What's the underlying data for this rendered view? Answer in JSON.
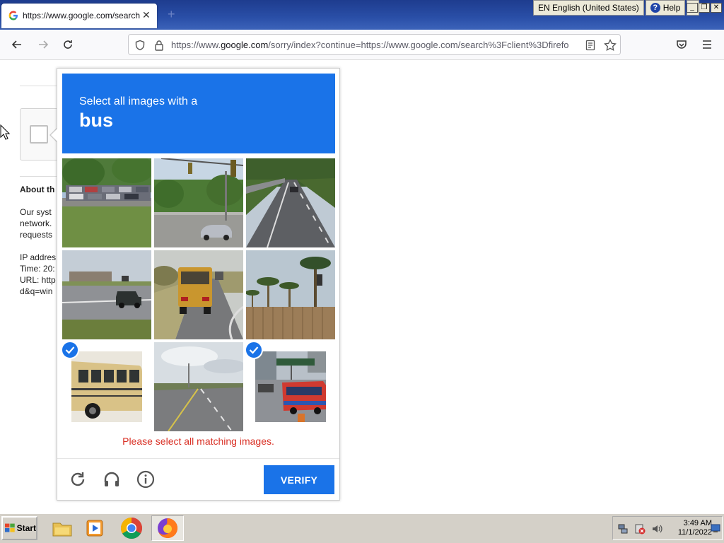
{
  "browser": {
    "tab_title": "https://www.google.com/search?c",
    "url_prefix": "https://www.",
    "url_domain": "google.com",
    "url_rest": "/sorry/index?continue=https://www.google.com/search%3Fclient%3Dfirefo"
  },
  "language_bar": {
    "language": "EN English (United States)",
    "help": "Help"
  },
  "background_page": {
    "heading": "About th",
    "lines": [
      "Our syst",
      "network.",
      "requests",
      "",
      "IP addres",
      "Time: 20:",
      "URL: http",
      "d&q=win"
    ]
  },
  "captcha": {
    "prompt": "Select all images with a",
    "keyword": "bus",
    "tiles": [
      {
        "subject": "car-carrier-truck",
        "selected": false
      },
      {
        "subject": "intersection-car",
        "selected": false
      },
      {
        "subject": "highway-car",
        "selected": false
      },
      {
        "subject": "road-suv",
        "selected": false
      },
      {
        "subject": "school-bus-rear",
        "selected": false
      },
      {
        "subject": "palm-trees-fence",
        "selected": false
      },
      {
        "subject": "school-bus-side",
        "selected": true
      },
      {
        "subject": "empty-highway",
        "selected": false
      },
      {
        "subject": "city-bus",
        "selected": true
      }
    ],
    "error_message": "Please select all matching images.",
    "verify_label": "VERIFY"
  },
  "taskbar": {
    "start_label": "Start",
    "time": "3:49 AM",
    "date": "11/1/2022"
  },
  "colors": {
    "captcha_blue": "#1a73e8",
    "error_red": "#d93025"
  }
}
